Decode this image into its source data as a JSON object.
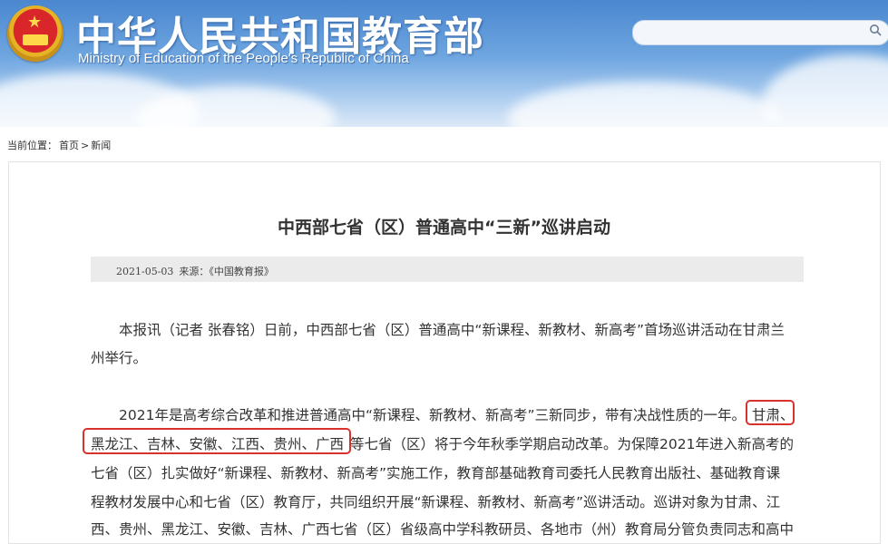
{
  "header": {
    "cn_title": "中华人民共和国教育部",
    "en_title": "Ministry of Education of the People's Republic of China",
    "emblem_icon": "national-emblem-icon",
    "search": {
      "placeholder": "",
      "icon": "search-icon"
    }
  },
  "breadcrumb": {
    "prefix": "当前位置：",
    "home": "首页",
    "separator": ">",
    "current": "新闻"
  },
  "article": {
    "title": "中西部七省（区）普通高中“三新”巡讲启动",
    "date": "2021-05-03",
    "source_label": "来源：",
    "source": "《中国教育报》",
    "p1": {
      "line1": "本报讯（记者 张春铭）日前，中西部七省（区）普通高中“新课程、新教材、新高考”首场巡讲活动在甘肃兰",
      "line2": "州举行。"
    },
    "p2": {
      "line1_a": "2021年是高考综合改革和推进普通高中“新课程、新教材、新高考”三新同步，带有决战性质的一年。",
      "line1_b": "甘肃、",
      "line2_a": "黑龙江、吉林、安徽、江西、贵州、广西",
      "line2_b": "等七省（区）将于今年秋季学期启动改革。为保障2021年进入新高考的",
      "line3": "七省（区）扎实做好“新课程、新教材、新高考”实施工作，教育部基础教育司委托人民教育出版社、基础教育课",
      "line4": "程教材发展中心和七省（区）教育厅，共同组织开展“新课程、新教材、新高考”巡讲活动。巡讲对象为甘肃、江",
      "line5": "西、贵州、黑龙江、安徽、吉林、广西七省（区）省级高中学科教研员、各地市（州）教育局分管负责同志和高中"
    }
  },
  "colors": {
    "banner_blue": "#4a87d0",
    "highlight_red": "#d8322f",
    "meta_bg": "#ebebeb",
    "text": "#333333"
  }
}
